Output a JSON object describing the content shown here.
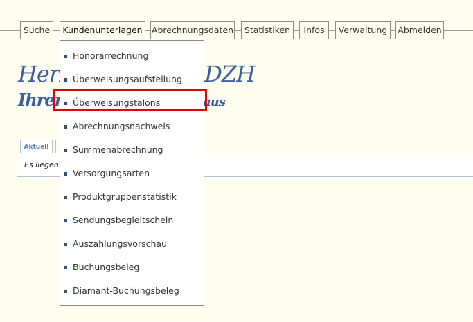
{
  "nav": [
    {
      "label": "Suche"
    },
    {
      "label": "Kundenunterlagen"
    },
    {
      "label": "Abrechnungsdaten"
    },
    {
      "label": "Statistiken"
    },
    {
      "label": "Infos"
    },
    {
      "label": "Verwaltung"
    },
    {
      "label": "Abmelden"
    }
  ],
  "dropdown": {
    "items": [
      {
        "label": "Honorarrechnung"
      },
      {
        "label": "Überweisungsaufstellung"
      },
      {
        "label": "Überweisungstalons"
      },
      {
        "label": "Abrechnungsnachweis"
      },
      {
        "label": "Summenabrechnung"
      },
      {
        "label": "Versorgungsarten"
      },
      {
        "label": "Produktgruppenstatistik"
      },
      {
        "label": "Sendungsbegleitschein"
      },
      {
        "label": "Auszahlungsvorschau"
      },
      {
        "label": "Buchungsbeleg"
      },
      {
        "label": "Diamant-Buchungsbeleg"
      }
    ]
  },
  "greeting": {
    "line1": "Herzl",
    "line1_end": "DZH",
    "line2": "Ihrem",
    "line2_end": "haus"
  },
  "tabs": {
    "active": "Aktuell"
  },
  "content": {
    "text": "Es liegen"
  },
  "colors": {
    "background": "#fffdf0",
    "accent": "#3a5f9e",
    "highlight": "#e60000"
  }
}
